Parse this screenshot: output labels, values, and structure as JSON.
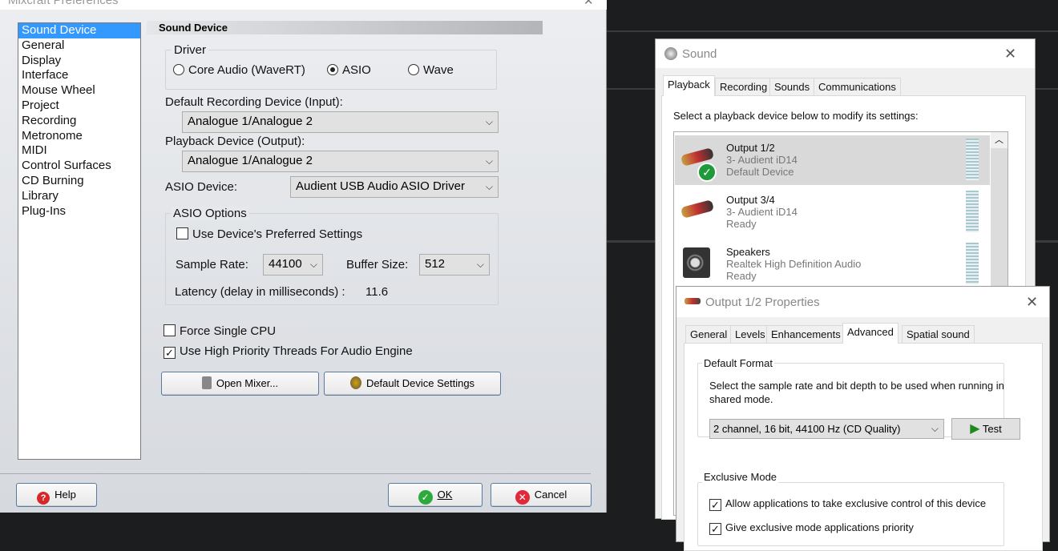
{
  "prefs": {
    "title": "Mixcraft Preferences",
    "nav": [
      "Sound Device",
      "General",
      "Display",
      "Interface",
      "Mouse Wheel",
      "Project",
      "Recording",
      "Metronome",
      "MIDI",
      "Control Surfaces",
      "CD Burning",
      "Library",
      "Plug-Ins"
    ],
    "selected_nav": "Sound Device",
    "header": "Sound Device",
    "driver": {
      "label": "Driver",
      "options": [
        "Core Audio (WaveRT)",
        "ASIO",
        "Wave"
      ],
      "selected": "ASIO"
    },
    "rec_label": "Default Recording Device (Input):",
    "rec_value": "Analogue 1/Analogue 2",
    "play_label": "Playback Device (Output):",
    "play_value": "Analogue 1/Analogue 2",
    "asio_label": "ASIO Device:",
    "asio_value": "Audient USB Audio ASIO Driver",
    "asio_opts": {
      "label": "ASIO Options",
      "preferred": "Use Device's Preferred Settings",
      "preferred_checked": false,
      "rate_label": "Sample Rate:",
      "rate": "44100",
      "buf_label": "Buffer Size:",
      "buf": "512",
      "latency_label": "Latency (delay in milliseconds) :",
      "latency": "11.6"
    },
    "force_cpu": "Force Single CPU",
    "force_cpu_checked": false,
    "high_prio": "Use High Priority Threads For Audio Engine",
    "high_prio_checked": true,
    "open_mixer": "Open Mixer...",
    "default_dev": "Default Device Settings",
    "help": "Help",
    "ok": "OK",
    "cancel": "Cancel"
  },
  "sound": {
    "title": "Sound",
    "tabs": [
      "Playback",
      "Recording",
      "Sounds",
      "Communications"
    ],
    "active_tab": "Playback",
    "instruction": "Select a playback device below to modify its settings:",
    "devices": [
      {
        "name": "Output 1/2",
        "sub": "3- Audient iD14",
        "status": "Default Device",
        "default": true
      },
      {
        "name": "Output 3/4",
        "sub": "3- Audient iD14",
        "status": "Ready"
      },
      {
        "name": "Speakers",
        "sub": "Realtek High Definition Audio",
        "status": "Ready"
      }
    ]
  },
  "props": {
    "title": "Output 1/2 Properties",
    "tabs": [
      "General",
      "Levels",
      "Enhancements",
      "Advanced",
      "Spatial sound"
    ],
    "active_tab": "Advanced",
    "format_group": "Default Format",
    "format_desc": "Select the sample rate and bit depth to be used when running in shared mode.",
    "format_value": "2 channel, 16 bit, 44100 Hz (CD Quality)",
    "test": "Test",
    "excl_group": "Exclusive Mode",
    "excl1": "Allow applications to take exclusive control of this device",
    "excl1_checked": true,
    "excl2": "Give exclusive mode applications priority",
    "excl2_checked": true
  },
  "colors": {
    "selection": "#3399ff",
    "ok_green": "#2eaa3c",
    "cancel_red": "#e0293a",
    "test_green": "#1e8a1e"
  }
}
